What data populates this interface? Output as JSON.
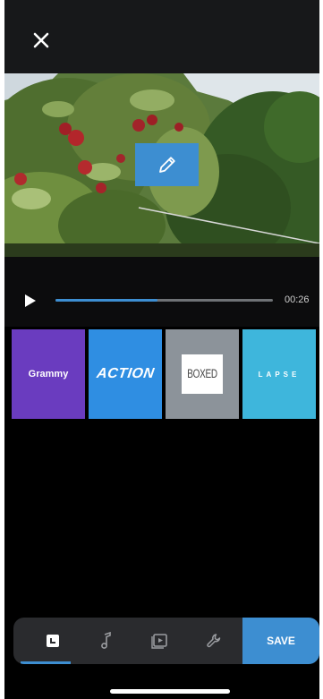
{
  "header": {
    "close_icon": "close-icon"
  },
  "preview": {
    "edit_icon": "pencil-icon"
  },
  "player": {
    "play_icon": "play-icon",
    "progress": 0.47,
    "time": "00:26"
  },
  "themes": [
    {
      "label": "Grammy",
      "color": "#6a3cbf"
    },
    {
      "label": "ACTION",
      "color": "#2f8ee2"
    },
    {
      "label": "BOXED",
      "color": "#8c939a"
    },
    {
      "label": "LAPSE",
      "color": "#3eb6dc"
    }
  ],
  "toolbar": {
    "tools": [
      {
        "icon": "themes-icon",
        "active": true
      },
      {
        "icon": "music-icon",
        "active": false
      },
      {
        "icon": "clip-icon",
        "active": false
      },
      {
        "icon": "settings-wrench-icon",
        "active": false
      }
    ],
    "save_label": "SAVE"
  },
  "colors": {
    "accent": "#3d8ed1",
    "background": "#000000",
    "toolbar": "#2a2b2e"
  }
}
